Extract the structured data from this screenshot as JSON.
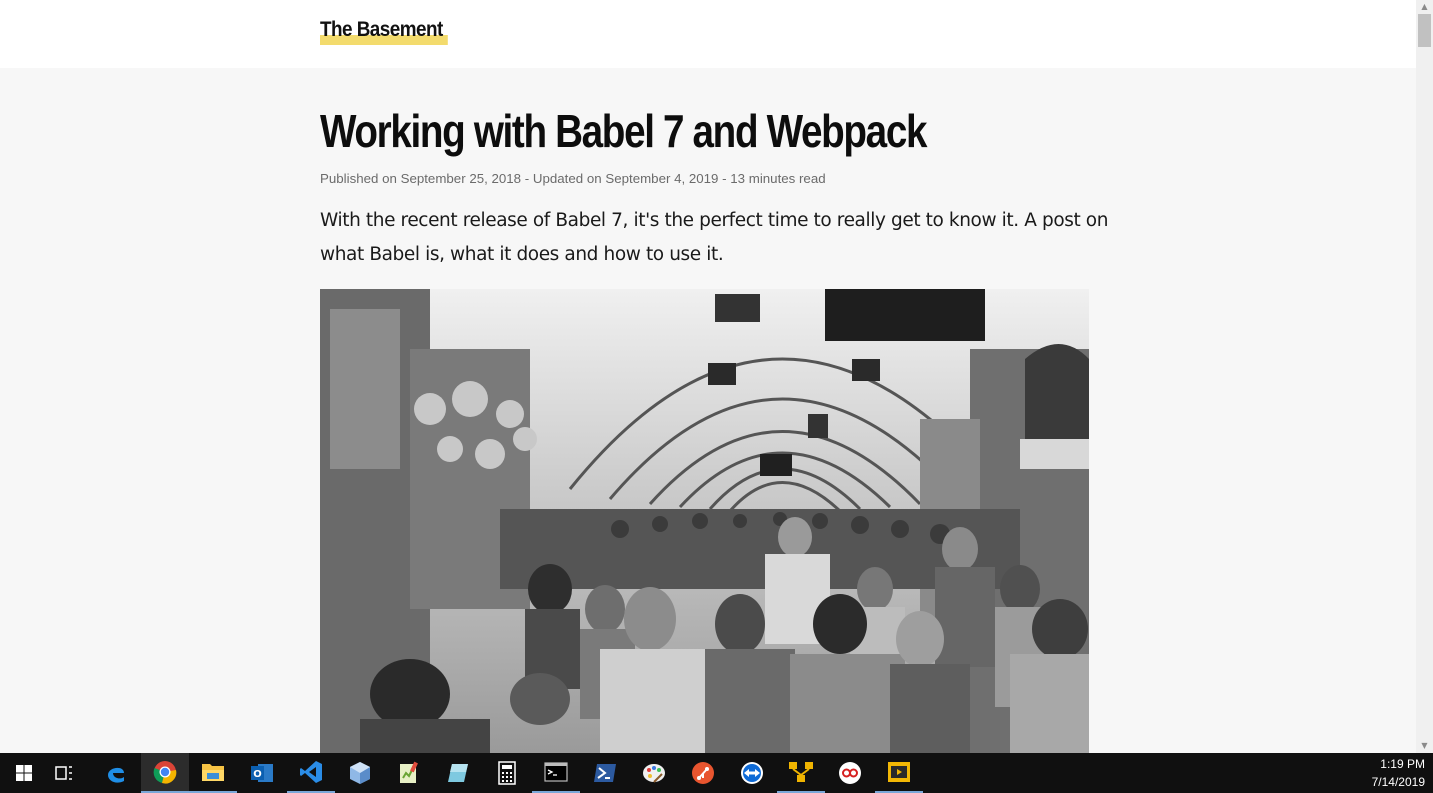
{
  "browser": {
    "page": {
      "site_title": "The Basement",
      "article": {
        "title": "Working with Babel 7 and Webpack",
        "meta": "Published on September 25, 2018 - Updated on September 4, 2019 - 13 minutes read",
        "lead": "With the recent release of Babel 7, it's the perfect time to really get to know it. A post on what Babel is, what it does and how to use it."
      }
    }
  },
  "taskbar": {
    "items": [
      {
        "name": "start-button",
        "icon": "windows-logo-icon"
      },
      {
        "name": "task-view-button",
        "icon": "task-view-icon"
      },
      {
        "name": "edge-button",
        "icon": "edge-icon"
      },
      {
        "name": "chrome-button",
        "icon": "chrome-icon",
        "active": true
      },
      {
        "name": "file-explorer-button",
        "icon": "folder-icon",
        "open": true
      },
      {
        "name": "outlook-button",
        "icon": "outlook-icon"
      },
      {
        "name": "vscode-button",
        "icon": "vscode-icon",
        "open": true
      },
      {
        "name": "cube-app-button",
        "icon": "cube-icon"
      },
      {
        "name": "notepadpp-button",
        "icon": "notepad-icon"
      },
      {
        "name": "tile-app-button",
        "icon": "tile-icon"
      },
      {
        "name": "calculator-button",
        "icon": "calculator-icon"
      },
      {
        "name": "terminal-button",
        "icon": "terminal-icon",
        "open": true
      },
      {
        "name": "powershell-button",
        "icon": "powershell-icon"
      },
      {
        "name": "paint-button",
        "icon": "paint-icon"
      },
      {
        "name": "git-button",
        "icon": "git-icon"
      },
      {
        "name": "teamviewer-button",
        "icon": "teamviewer-icon"
      },
      {
        "name": "filezilla-button",
        "icon": "network-icon",
        "open": true
      },
      {
        "name": "screen-recorder-button",
        "icon": "record-icon"
      },
      {
        "name": "video-app-button",
        "icon": "video-icon",
        "open": true
      }
    ],
    "clock": {
      "time": "1:19 PM",
      "date": "7/14/2019"
    }
  }
}
